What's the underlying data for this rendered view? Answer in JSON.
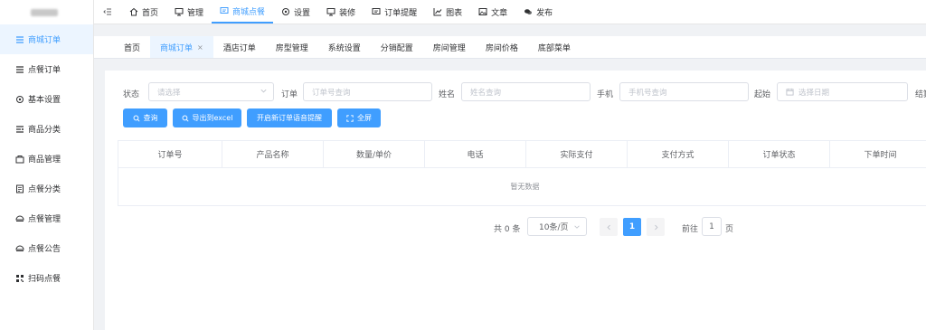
{
  "sidebar": {
    "items": [
      {
        "label": "商城订单",
        "icon": "list-icon",
        "active": true
      },
      {
        "label": "点餐订单",
        "icon": "list-icon"
      },
      {
        "label": "基本设置",
        "icon": "gear-icon"
      },
      {
        "label": "商品分类",
        "icon": "category-icon"
      },
      {
        "label": "商品管理",
        "icon": "shop-icon"
      },
      {
        "label": "点餐分类",
        "icon": "document-icon"
      },
      {
        "label": "点餐管理",
        "icon": "food-icon"
      },
      {
        "label": "点餐公告",
        "icon": "food-icon"
      },
      {
        "label": "扫码点餐",
        "icon": "qrcode-icon"
      }
    ]
  },
  "topnav": {
    "items": [
      {
        "label": "首页",
        "icon": "home-icon"
      },
      {
        "label": "管理",
        "icon": "monitor-icon"
      },
      {
        "label": "商城点餐",
        "icon": "message-icon",
        "active": true
      },
      {
        "label": "设置",
        "icon": "gear-icon"
      },
      {
        "label": "装修",
        "icon": "monitor-icon"
      },
      {
        "label": "订单提醒",
        "icon": "message-icon"
      },
      {
        "label": "图表",
        "icon": "chart-icon"
      },
      {
        "label": "文章",
        "icon": "picture-icon"
      },
      {
        "label": "发布",
        "icon": "chat-icon"
      }
    ]
  },
  "tabs": {
    "items": [
      {
        "label": "首页"
      },
      {
        "label": "商城订单",
        "active": true,
        "closable": true
      },
      {
        "label": "酒店订单"
      },
      {
        "label": "房型管理"
      },
      {
        "label": "系统设置"
      },
      {
        "label": "分销配置"
      },
      {
        "label": "房间管理"
      },
      {
        "label": "房间价格"
      },
      {
        "label": "底部菜单"
      }
    ],
    "close_glyph": "×"
  },
  "filters": {
    "status_label": "状态",
    "status_placeholder": "请选择",
    "order_label": "订单",
    "order_placeholder": "订单号查询",
    "name_label": "姓名",
    "name_placeholder": "姓名查询",
    "phone_label": "手机",
    "phone_placeholder": "手机号查询",
    "start_label": "起始",
    "start_placeholder": "选择日期",
    "end_label_partial": "结算"
  },
  "actions": {
    "query": "查询",
    "export": "导出到excel",
    "voice": "开启新订单语音提醒",
    "fullscreen": "全屏"
  },
  "table": {
    "columns": [
      "订单号",
      "产品名称",
      "数量/单价",
      "电话",
      "实际支付",
      "支付方式",
      "订单状态",
      "下单时间"
    ],
    "empty_text": "暂无数据"
  },
  "pagination": {
    "total_text": "共 0 条",
    "page_size": "10条/页",
    "current_page": "1",
    "goto_label": "前往",
    "goto_value": "1",
    "page_suffix": "页"
  },
  "colors": {
    "accent": "#409eff",
    "active_bg": "#ecf5ff"
  }
}
